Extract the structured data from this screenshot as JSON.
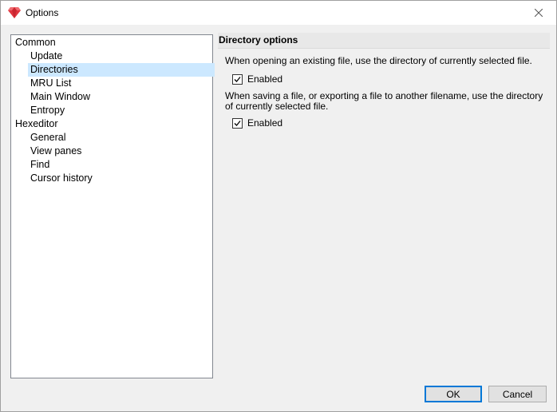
{
  "window": {
    "title": "Options",
    "close_glyph": "✕"
  },
  "tree": {
    "items": [
      {
        "label": "Common",
        "level": 0,
        "selected": false
      },
      {
        "label": "Update",
        "level": 1,
        "selected": false
      },
      {
        "label": "Directories",
        "level": 1,
        "selected": true
      },
      {
        "label": "MRU List",
        "level": 1,
        "selected": false
      },
      {
        "label": "Main Window",
        "level": 1,
        "selected": false
      },
      {
        "label": "Entropy",
        "level": 1,
        "selected": false
      },
      {
        "label": "Hexeditor",
        "level": 0,
        "selected": false
      },
      {
        "label": "General",
        "level": 1,
        "selected": false
      },
      {
        "label": "View panes",
        "level": 1,
        "selected": false
      },
      {
        "label": "Find",
        "level": 1,
        "selected": false
      },
      {
        "label": "Cursor history",
        "level": 1,
        "selected": false
      }
    ]
  },
  "panel": {
    "header": "Directory options",
    "open_desc": "When opening an existing file, use the directory of currently selected file.",
    "open_checkbox": {
      "label": "Enabled",
      "checked": true
    },
    "save_desc": "When saving a file, or exporting a file to another filename, use the directory of currently selected file.",
    "save_checkbox": {
      "label": "Enabled",
      "checked": true
    }
  },
  "buttons": {
    "ok": "OK",
    "cancel": "Cancel"
  },
  "colors": {
    "selection": "#cce8ff",
    "accent": "#0078d7",
    "app_icon": "#e0353f"
  }
}
